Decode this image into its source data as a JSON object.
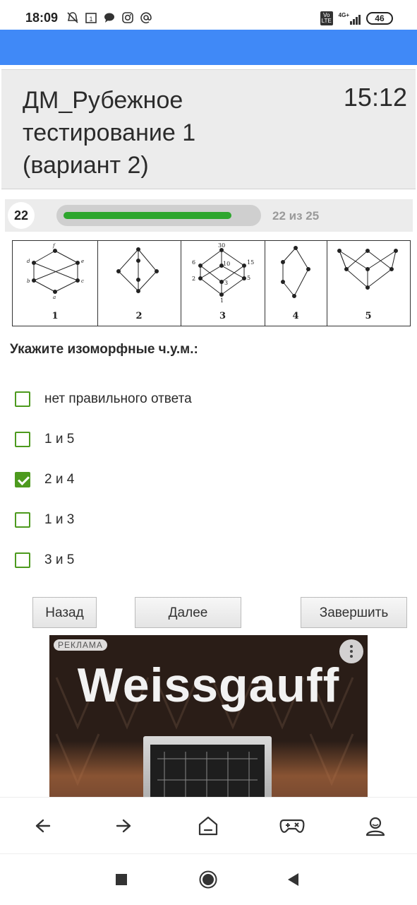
{
  "status_bar": {
    "time": "18:09",
    "notification_icons": [
      "mute-icon",
      "calendar-icon",
      "chat-icon",
      "instagram-icon",
      "at-sign-icon"
    ],
    "network": "4G+",
    "volte": "Vo LTE",
    "battery": "46"
  },
  "header": {
    "title": "ДМ_Рубежное тестирование 1 (вариант 2)",
    "timer": "15:12"
  },
  "progress": {
    "question_number": "22",
    "label": "22 из 25",
    "fraction": 0.88,
    "color": "#2ea62e"
  },
  "figure": {
    "labels": [
      "1",
      "2",
      "3",
      "4",
      "5"
    ],
    "graph3_labels": [
      "30",
      "6",
      "10",
      "15",
      "2",
      "3",
      "5",
      "1"
    ],
    "graph1_labels": [
      "f",
      "d",
      "e",
      "b",
      "c",
      "a"
    ]
  },
  "question": {
    "text": "Укажите изоморфные ч.у.м.:",
    "options": [
      {
        "label": "нет правильного ответа",
        "checked": false
      },
      {
        "label": "1 и 5",
        "checked": false
      },
      {
        "label": "2 и 4",
        "checked": true
      },
      {
        "label": "1 и 3",
        "checked": false
      },
      {
        "label": "3 и 5",
        "checked": false
      }
    ]
  },
  "buttons": {
    "back": "Назад",
    "next": "Далее",
    "finish": "Завершить"
  },
  "ad": {
    "tag": "РЕКЛАМА",
    "brand": "Weissgauff"
  },
  "bottom_nav": [
    "back-arrow-icon",
    "forward-arrow-icon",
    "home-icon",
    "gamepad-icon",
    "profile-icon"
  ],
  "colors": {
    "blue_bar": "#4089f7",
    "checkbox_green": "#4d9a1e",
    "progress_green": "#2ea62e"
  }
}
